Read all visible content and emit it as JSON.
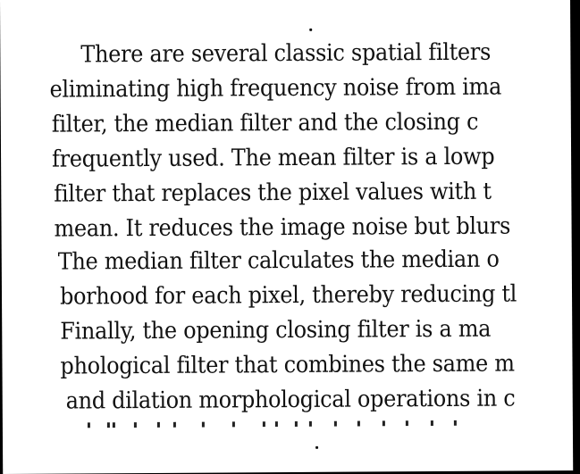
{
  "document": {
    "lines": [
      "There are several classic spatial filters",
      "eliminating high frequency noise from ima",
      "filter, the median filter and the closing c",
      "frequently used. The mean filter is a lowp",
      "filter that replaces the pixel values with t",
      "mean. It reduces the image noise but blurs",
      "The median filter calculates the median o",
      "borhood for each pixel, thereby reducing tl",
      "Finally, the opening closing filter is a ma",
      "phological filter that combines the same m",
      "and dilation morphological operations in c"
    ]
  }
}
